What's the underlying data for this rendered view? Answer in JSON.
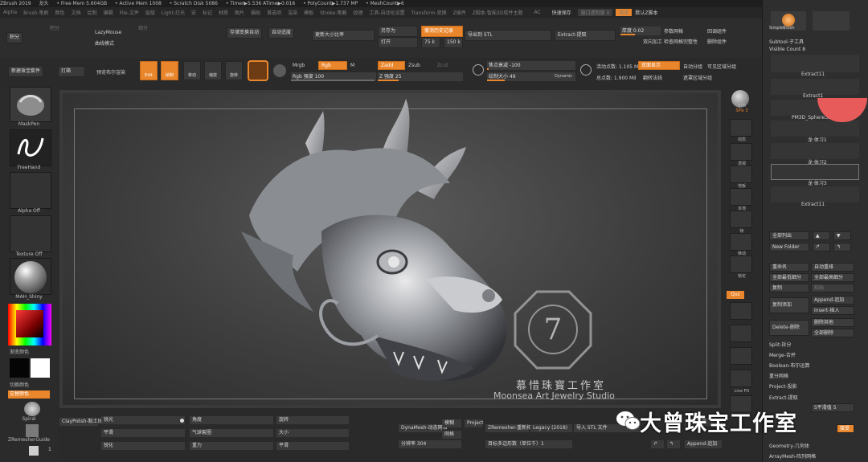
{
  "titlebar": {
    "app": "ZBrush 2019",
    "doc": "龙头",
    "free_mem": "• Free Mem 5.604GB",
    "active_mem": "• Active Mem 1008",
    "scratch": "• Scratch Disk 5086",
    "timer": "• Timer▶5.536 ATime▶0.016",
    "poly": "• PolyCount▶1.737 MP",
    "mesh": "• MeshCount▶6"
  },
  "menubar": {
    "items": [
      "Alpha",
      "Brush-笔刷",
      "颜色",
      "文档",
      "绘制",
      "编辑",
      "File-文件",
      "层级",
      "Light-灯光",
      "宏",
      "标记",
      "材质",
      "图片",
      "描贴",
      "首选项",
      "渲染",
      "模板",
      "Stroke-笔触",
      "纹理",
      "工具-自动化设置",
      "Transform-变换",
      "Z插件",
      "Z脚本-智能3D软件主题"
    ],
    "ac": "AC",
    "quicksave": "快速保存",
    "transparency": "窗口透明度 0",
    "menus": "菜单",
    "default": "默认Z脚本"
  },
  "shelf1": {
    "a1": "积分",
    "a2": "LazyMouse",
    "a3": "曲线模式",
    "b1": "存储变换自动",
    "b2": "自动适度",
    "c1": "更新大小比率",
    "d1": "另存为",
    "d2": "打开",
    "e1": "撤消历史记录",
    "e2": "75 k",
    "e3": "150 k",
    "f1": "导出到 STL",
    "g1": "Extract-提取",
    "h1": "厚度 0.02",
    "h2": "参数网格",
    "h3": "双向加工",
    "h4": "回调组件",
    "h5": "检查网格完整性",
    "h6": "删除组件"
  },
  "shelf2": {
    "s1": "新建珠宝套件",
    "s2": "灯箱",
    "s3": "预览布尔渲染",
    "edit": "Edit",
    "draw": "绘制",
    "move": "移动",
    "scale": "缩放",
    "rotate": "旋转",
    "mrgb": "Mrgb",
    "rgb": "Rgb",
    "m": "M",
    "zadd": "Zadd",
    "zsub": "Zsub",
    "zcut": "Zcut",
    "rgb_int": "Rgb 强度 100",
    "z_int": "Z 强度 25",
    "focal": "焦点衰减 -100",
    "draw_size": "绘制大小 49",
    "dynamic": "Dynamic",
    "active_pts": "活动点数: 1.105 M",
    "total_pts": "总点数: 1.900 Mil",
    "double": "双面显示",
    "flip": "翻转法线",
    "auto_group": "自动分组",
    "visible_grp": "可见区域分组",
    "mask_grp": "遮罩区域分组"
  },
  "lefttray": {
    "brush": "MaskPen",
    "stroke": "FreeHand",
    "alpha": "Alpha Off",
    "texture": "Texture Off",
    "material": "MAH_Shiny",
    "main_color": "渐变颜色",
    "switch_color": "切换颜色",
    "alt_color": "交替颜色",
    "spiral": "Spiral",
    "zremesher": "ZRemesherGuide",
    "num": "1"
  },
  "rstrip": {
    "bpr": "BPR",
    "spix": "SPix 3",
    "dynamic": "动态",
    "persp": "透视",
    "floor": "地板",
    "local": "本地",
    "lsym": "L.Sym",
    "gizmo": "Gizmo",
    "frame": "帧",
    "move": "移动",
    "zoom": "缩放",
    "rotate": "旋转",
    "polyf": "PolyF",
    "transp": "透明",
    "ghost": "Ghost",
    "solo": "Solo",
    "xpose": "Xpose",
    "dyn": "Dynamic",
    "lock": "锁定",
    "qvz": "Qvz",
    "linefill": "Line Fill"
  },
  "rpanel": {
    "simplebrush": "SimpleBrush",
    "subtool_title": "Subtool-子工具",
    "visible_count": "Visible Count 8",
    "items": [
      "Extract11",
      "Extract1",
      "PM3D_Sphere3D",
      "龙·体习1",
      "龙·体习2",
      "龙·体习3",
      "Extract11"
    ],
    "list_all": "全部列出",
    "new_folder": "New Folder",
    "rename": "重命名",
    "auto_reorder": "自动重排",
    "all_low": "全部最低细分",
    "all_high": "全部最高细分",
    "copy": "复制",
    "paste": "粘贴",
    "dup_add": "复制添加",
    "append": "Append-追加",
    "insert": "Insert-插入",
    "delete": "Delete-删除",
    "del_other": "删除其他",
    "del_all": "全部删除",
    "split": "Split-拆分",
    "merge": "Merge-合并",
    "boolean": "Boolean-布尔运算",
    "remesh": "重分网格",
    "project": "Project-投影",
    "extract": "Extract-提取",
    "s_smooth": "S平滑值 5",
    "accept": "接受",
    "geometry": "Geometry-几何体",
    "arraymesh": "ArrayMesh-阵列网格"
  },
  "bottombar": {
    "claypolish": "ClayPolish-黏土抛光",
    "sharp": "锐光",
    "flat": "平滑",
    "sharpen": "锐化",
    "angle": "角度",
    "airbrush": "气球套圈",
    "weight": "重力",
    "rotate": "旋转",
    "size": "大小",
    "dynamesh": "DynaMesh-动态网格",
    "blur": "模糊",
    "resolution": "分辨率 304",
    "project": "Project",
    "smooth": "网格",
    "zremesher": "ZRemesher-重新拓扑",
    "legacy": "Legacy (2018)",
    "target": "目标多边形数（单位千）1",
    "import_stl": "导入 STL 文件",
    "append": "Append-追加",
    "up": "向下合并"
  },
  "watermark": {
    "title": "大曾珠宝工作室",
    "studio_cn": "慕惜珠寳工作室",
    "studio_en": "Moonsea Art Jewelry Studio",
    "logo_letter": "7"
  }
}
